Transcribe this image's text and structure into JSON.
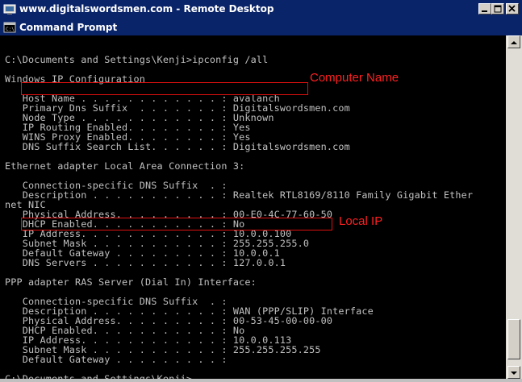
{
  "remote_desktop": {
    "title": "www.digitalswordsmen.com - Remote Desktop"
  },
  "command_prompt": {
    "title": "Command Prompt"
  },
  "console": {
    "lines": [
      "",
      "C:\\Documents and Settings\\Kenji>ipconfig /all",
      "",
      "Windows IP Configuration",
      "",
      "   Host Name . . . . . . . . . . . . : avalanch",
      "   Primary Dns Suffix  . . . . . . . : Digitalswordsmen.com",
      "   Node Type . . . . . . . . . . . . : Unknown",
      "   IP Routing Enabled. . . . . . . . : Yes",
      "   WINS Proxy Enabled. . . . . . . . : Yes",
      "   DNS Suffix Search List. . . . . . : Digitalswordsmen.com",
      "",
      "Ethernet adapter Local Area Connection 3:",
      "",
      "   Connection-specific DNS Suffix  . :",
      "   Description . . . . . . . . . . . : Realtek RTL8169/8110 Family Gigabit Ether",
      "net NIC",
      "   Physical Address. . . . . . . . . : 00-E0-4C-77-60-50",
      "   DHCP Enabled. . . . . . . . . . . : No",
      "   IP Address. . . . . . . . . . . . : 10.0.0.100",
      "   Subnet Mask . . . . . . . . . . . : 255.255.255.0",
      "   Default Gateway . . . . . . . . . : 10.0.0.1",
      "   DNS Servers . . . . . . . . . . . : 127.0.0.1",
      "",
      "PPP adapter RAS Server (Dial In) Interface:",
      "",
      "   Connection-specific DNS Suffix  . :",
      "   Description . . . . . . . . . . . : WAN (PPP/SLIP) Interface",
      "   Physical Address. . . . . . . . . : 00-53-45-00-00-00",
      "   DHCP Enabled. . . . . . . . . . . : No",
      "   IP Address. . . . . . . . . . . . : 10.0.0.113",
      "   Subnet Mask . . . . . . . . . . . : 255.255.255.255",
      "   Default Gateway . . . . . . . . . :",
      "",
      "C:\\Documents and Settings\\Kenji>"
    ]
  },
  "annotations": {
    "computer_name": "Computer Name",
    "local_ip": "Local IP",
    "color": "#ff2020"
  },
  "icons": {
    "rd_icon": "remote-desktop-icon",
    "cmd_icon": "command-prompt-icon",
    "minimize": "minimize-icon",
    "maximize": "maximize-icon",
    "close": "close-icon"
  }
}
